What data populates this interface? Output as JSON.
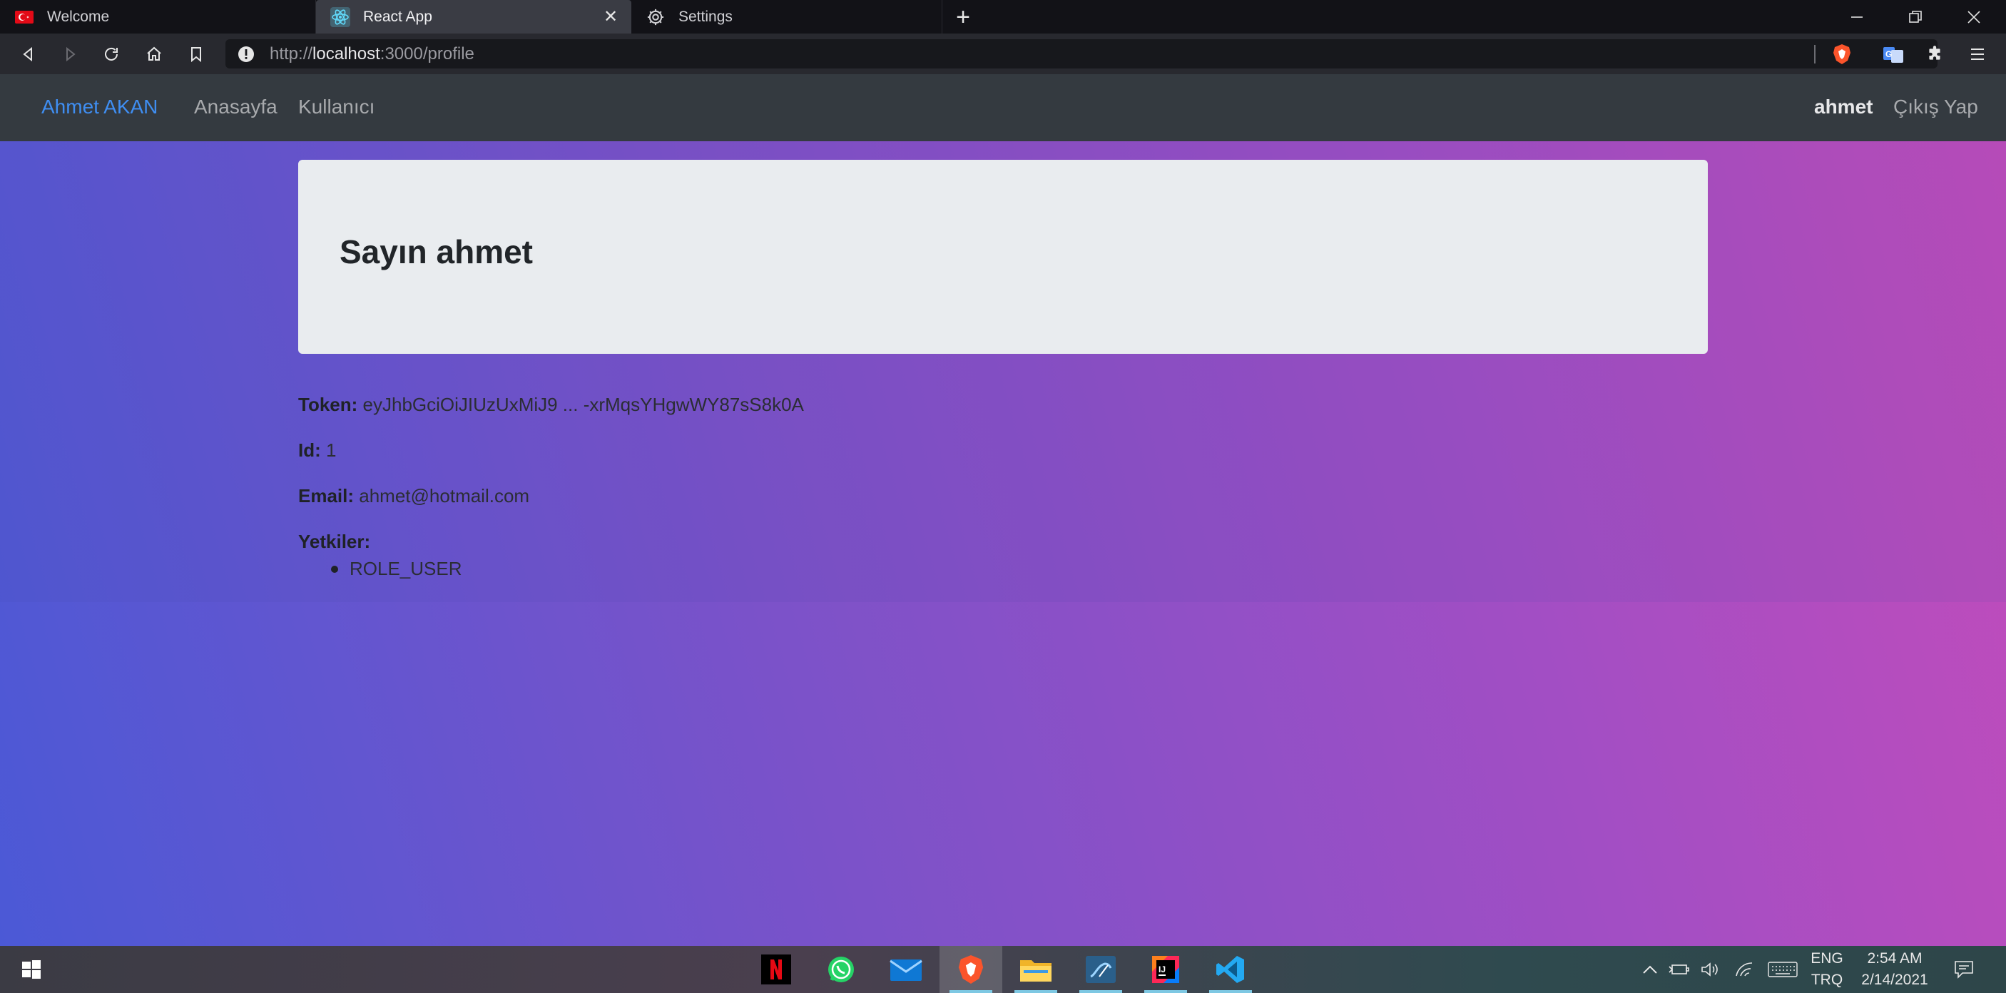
{
  "browser": {
    "tabs": [
      {
        "label": "Welcome",
        "icon": "turkey-flag-icon"
      },
      {
        "label": "React App",
        "icon": "react-icon"
      },
      {
        "label": "Settings",
        "icon": "gear-icon"
      }
    ],
    "address": {
      "scheme": "http://",
      "host": "localhost",
      "path": ":3000/profile"
    }
  },
  "navbar": {
    "brand": "Ahmet AKAN",
    "links": [
      "Anasayfa",
      "Kullanıcı"
    ],
    "username": "ahmet",
    "logout": "Çıkış Yap"
  },
  "profile": {
    "greeting_prefix": "Sayın",
    "greeting_name": "ahmet",
    "token_label": "Token:",
    "token_value": "eyJhbGciOiJIUzUxMiJ9 ... -xrMqsYHgwWY87sS8k0A",
    "id_label": "Id:",
    "id_value": "1",
    "email_label": "Email:",
    "email_value": "ahmet@hotmail.com",
    "roles_label": "Yetkiler:",
    "roles": [
      "ROLE_USER"
    ]
  },
  "taskbar": {
    "language": "ENG",
    "keyboard": "TRQ",
    "time": "2:54 AM",
    "date": "2/14/2021"
  },
  "colors": {
    "brand_link": "#3f8ef2",
    "navbar_bg": "#343a40",
    "jumbotron_bg": "#e9ecef",
    "gradient_start": "#4b59d6",
    "gradient_end": "#c44cba"
  }
}
